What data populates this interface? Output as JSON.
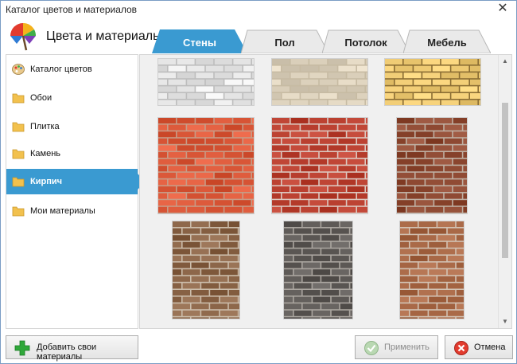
{
  "window": {
    "title": "Каталог цветов и материалов",
    "close_glyph": "✕"
  },
  "header": {
    "title": "Цвета и материалы",
    "logo_icon": "umbrella-icon"
  },
  "tabs": [
    {
      "label": "Стены",
      "active": true
    },
    {
      "label": "Пол",
      "active": false
    },
    {
      "label": "Потолок",
      "active": false
    },
    {
      "label": "Мебель",
      "active": false
    }
  ],
  "sidebar": {
    "items": [
      {
        "label": "Каталог цветов",
        "icon": "palette-icon",
        "active": false
      },
      {
        "label": "Обои",
        "icon": "folder-icon",
        "active": false
      },
      {
        "label": "Плитка",
        "icon": "folder-icon",
        "active": false
      },
      {
        "label": "Камень",
        "icon": "folder-icon",
        "active": false
      },
      {
        "label": "Кирпич",
        "icon": "folder-icon",
        "active": true
      },
      {
        "label": "Мои материалы",
        "icon": "folder-icon",
        "active": false
      }
    ]
  },
  "materials": [
    {
      "texture": "white-brick",
      "base": "#e6e6e6",
      "mortar": "#bdbdbd"
    },
    {
      "texture": "beige-brick",
      "base": "#ddd2bd",
      "mortar": "#c7bba3"
    },
    {
      "texture": "yellow-brick",
      "base": "#efcb74",
      "mortar": "#8a6d34"
    },
    {
      "texture": "orange-red-brick",
      "base": "#dd5a3b",
      "mortar": "#c79b86"
    },
    {
      "texture": "red-brick",
      "base": "#bd4333",
      "mortar": "#dcc8c0"
    },
    {
      "texture": "dark-red-brick",
      "base": "#8f4a33",
      "mortar": "#bfb0a3"
    },
    {
      "texture": "brown-brick",
      "base": "#8a6447",
      "mortar": "#cbbcaa"
    },
    {
      "texture": "gray-brick",
      "base": "#5e5a57",
      "mortar": "#aaa59f"
    },
    {
      "texture": "rust-brick",
      "base": "#a76745",
      "mortar": "#d2c2b3"
    }
  ],
  "buttons": {
    "add": {
      "label": "Добавить свои материалы",
      "icon": "plus-icon"
    },
    "apply": {
      "label": "Применить",
      "icon": "check-icon",
      "disabled": true
    },
    "cancel": {
      "label": "Отмена",
      "icon": "cancel-icon"
    }
  },
  "colors": {
    "accent": "#3a9ad1",
    "tab_inactive": "#eaeaea"
  }
}
